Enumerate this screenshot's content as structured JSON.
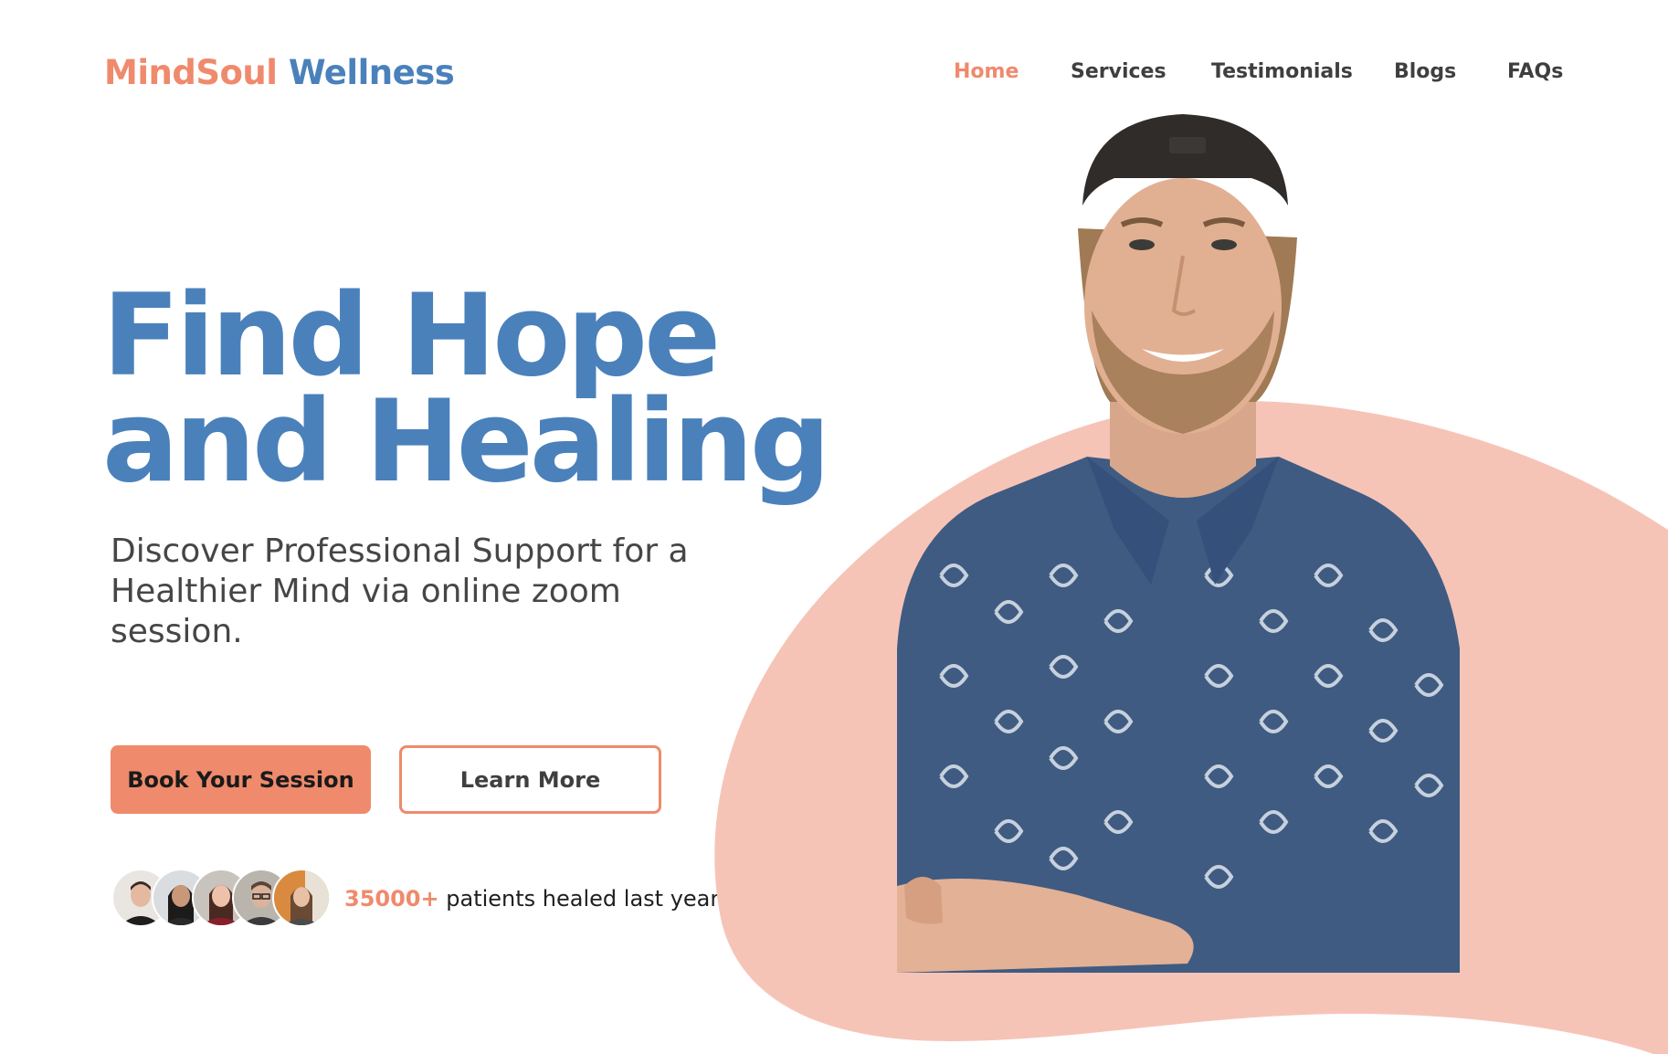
{
  "brand": {
    "name_part1": "MindSoul",
    "name_part2": "Wellness"
  },
  "nav": {
    "items": [
      "Home",
      "Services",
      "Testimonials",
      "Blogs",
      "FAQs"
    ],
    "active": "Home"
  },
  "hero": {
    "headline_line1": "Find Hope",
    "headline_line2": "and Healing",
    "subtext": "Discover Professional Support for a Healthier Mind via online zoom session.",
    "primary_button": "Book Your Session",
    "secondary_button": "Learn More"
  },
  "social_proof": {
    "count": "35000+",
    "text": "patients healed last year.",
    "avatar_count": 5
  },
  "colors": {
    "accent": "#ef8a6c",
    "brand_blue": "#4a81bb",
    "blob": "#f6c4b7",
    "text_dark": "#3f3f3f"
  },
  "icons": {
    "hero_image": "smiling-man-photo",
    "avatars": "patient-avatar"
  }
}
